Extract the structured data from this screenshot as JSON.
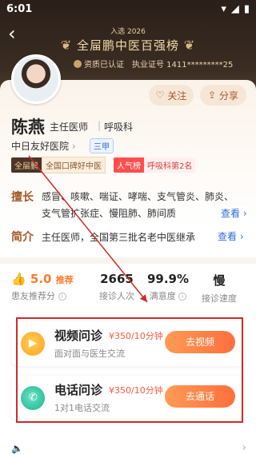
{
  "status_bar": {
    "time": "6:01"
  },
  "award": {
    "year": "入选 2026",
    "title": "全屇鹏中医百强榜"
  },
  "cert": {
    "certified": "资质已认证",
    "license": "执业证号 1411*********25"
  },
  "actions": {
    "follow": "关注",
    "share": "分享"
  },
  "doctor": {
    "name": "陈燕",
    "title": "主任医师",
    "dept": "呼吸科",
    "hospital": "中日友好医院",
    "grade": "三甲"
  },
  "tags": {
    "brand": "全屇鹏",
    "brand_desc": "全国口碑好中医",
    "popular": "人气榜",
    "popular_desc": "呼吸科第2名"
  },
  "specialty": {
    "label": "擅长",
    "text": "感冒、咳嗽、喘证、哮喘、支气管炎、肺炎、支气管扩张症、慢阻肺、肺间质",
    "more": "查看"
  },
  "intro": {
    "label": "简介",
    "text": "主任医师，全国第三批名老中医继承",
    "more": "查看"
  },
  "stats": {
    "rating": "5.0",
    "rating_suffix": "推荐",
    "rating_label": "患友推荐分",
    "count": "2665",
    "count_label": "接诊人次",
    "satisfaction": "99.9%",
    "satisfaction_label": "满意度",
    "speed": "慢",
    "speed_label": "接诊速度"
  },
  "services": [
    {
      "name": "视频问诊",
      "price": "¥350/10分钟",
      "desc": "面对面与医生交流",
      "button": "去视频",
      "icon": "video-icon"
    },
    {
      "name": "电话问诊",
      "price": "¥350/10分钟",
      "desc": "1对1电话交流",
      "button": "去通话",
      "icon": "phone-icon"
    }
  ],
  "colors": {
    "accent": "#ff6f3d",
    "brand_gold": "#a4592a",
    "highlight_box": "#d02a2a"
  }
}
